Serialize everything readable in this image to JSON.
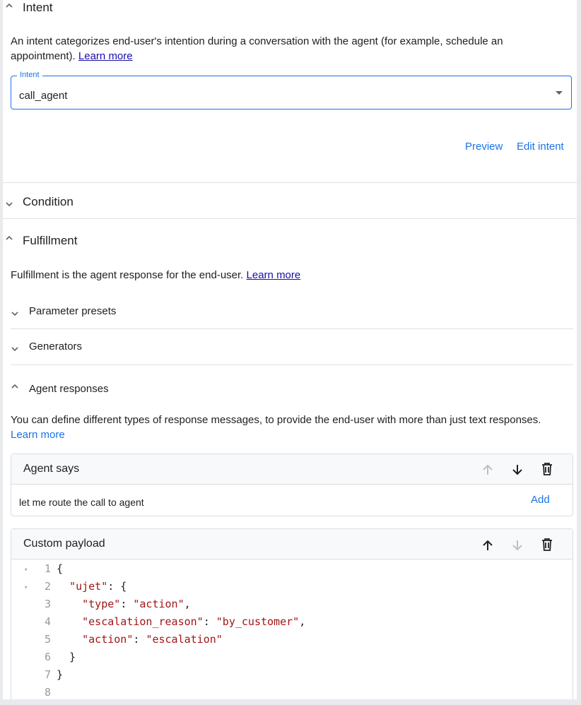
{
  "intent_section": {
    "title": "Intent",
    "description": "An intent categorizes end-user's intention during a conversation with the agent (for example, schedule an appointment).",
    "learn_more": "Learn more",
    "field_label": "Intent",
    "field_value": "call_agent",
    "preview_label": "Preview",
    "edit_label": "Edit intent"
  },
  "condition_section": {
    "title": "Condition"
  },
  "fulfillment_section": {
    "title": "Fulfillment",
    "description": "Fulfillment is the agent response for the end-user.",
    "learn_more": "Learn more",
    "parameter_presets": "Parameter presets",
    "generators": "Generators",
    "agent_responses": "Agent responses",
    "responses_description": "You can define different types of response messages, to provide the end-user with more than just text responses.",
    "responses_learn_more": "Learn more"
  },
  "agent_says_card": {
    "title": "Agent says",
    "text": "let me route the call to agent",
    "add_label": "Add"
  },
  "custom_payload_card": {
    "title": "Custom payload",
    "lines": [
      {
        "n": "1",
        "fold": "▾",
        "text": "{"
      },
      {
        "n": "2",
        "fold": "▾",
        "text": "  \"ujet\": {"
      },
      {
        "n": "3",
        "fold": "",
        "text": "    \"type\": \"action\","
      },
      {
        "n": "4",
        "fold": "",
        "text": "    \"escalation_reason\": \"by_customer\","
      },
      {
        "n": "5",
        "fold": "",
        "text": "    \"action\": \"escalation\""
      },
      {
        "n": "6",
        "fold": "",
        "text": "  }"
      },
      {
        "n": "7",
        "fold": "",
        "text": "}"
      },
      {
        "n": "8",
        "fold": "",
        "text": ""
      }
    ]
  },
  "colors": {
    "accent": "#1a73e8",
    "string": "#a31515",
    "link": "#1a0dab"
  }
}
